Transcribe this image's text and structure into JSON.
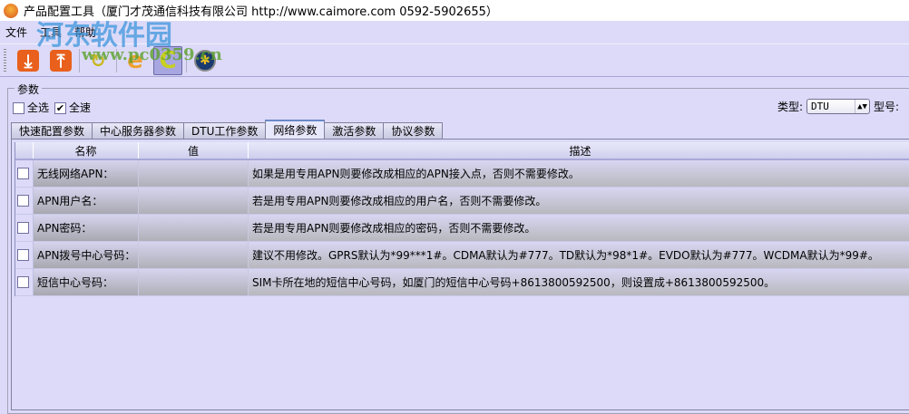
{
  "window": {
    "title": "产品配置工具（厦门才茂通信科技有限公司  http://www.caimore.com  0592-5902655）"
  },
  "menu": [
    "文件",
    "工具",
    "帮助"
  ],
  "toolbar": [
    {
      "icon": "download-icon",
      "color": "#e8601c"
    },
    {
      "icon": "upload-icon",
      "color": "#e8601c"
    },
    {
      "icon": "refresh-icon",
      "color": "#c8b820"
    },
    {
      "icon": "e-icon",
      "color": "#f0a030"
    },
    {
      "icon": "c-icon",
      "color": "#c8d020"
    },
    {
      "icon": "run-icon",
      "color": "#1a3a70"
    }
  ],
  "watermark": {
    "text": "河东软件园",
    "url": "www.pc0359.cn"
  },
  "params": {
    "group_label": "参数",
    "select_all": "全选",
    "full_speed": "全速",
    "select_all_checked": false,
    "full_speed_checked": true,
    "type_label": "类型:",
    "type_value": "DTU",
    "model_label": "型号:"
  },
  "tabs": [
    "快速配置参数",
    "中心服务器参数",
    "DTU工作参数",
    "网络参数",
    "激活参数",
    "协议参数"
  ],
  "active_tab": 3,
  "table": {
    "headers": [
      "名称",
      "值",
      "描述"
    ],
    "rows": [
      {
        "name": "无线网络APN：",
        "value": "",
        "desc": "如果是用专用APN则要修改成相应的APN接入点，否则不需要修改。"
      },
      {
        "name": "APN用户名：",
        "value": "",
        "desc": "若是用专用APN则要修改成相应的用户名，否则不需要修改。"
      },
      {
        "name": "APN密码：",
        "value": "",
        "desc": "若是用专用APN则要修改成相应的密码，否则不需要修改。"
      },
      {
        "name": "APN拨号中心号码：",
        "value": "",
        "desc": "建议不用修改。GPRS默认为*99***1#。CDMA默认为#777。TD默认为*98*1#。EVDO默认为#777。WCDMA默认为*99#。"
      },
      {
        "name": "短信中心号码：",
        "value": "",
        "desc": "SIM卡所在地的短信中心号码，如厦门的短信中心号码+8613800592500，则设置成+8613800592500。"
      }
    ]
  }
}
